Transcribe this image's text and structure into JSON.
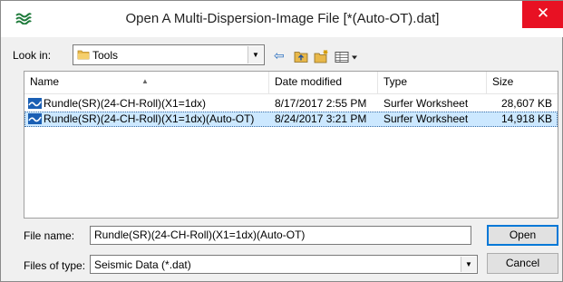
{
  "window": {
    "title": "Open A Multi-Dispersion-Image File [*(Auto-OT).dat]",
    "close_glyph": "✕"
  },
  "lookin": {
    "label": "Look in:",
    "value": "Tools",
    "icons": [
      "folder-icon",
      "back-arrow-icon",
      "up-folder-icon",
      "new-folder-icon",
      "view-menu-icon"
    ]
  },
  "columns": [
    "Name",
    "Date modified",
    "Type",
    "Size"
  ],
  "files": [
    {
      "name": "Rundle(SR)(24-CH-Roll)(X1=1dx)",
      "date": "8/17/2017 2:55 PM",
      "type": "Surfer Worksheet",
      "size": "28,607 KB",
      "selected": false
    },
    {
      "name": "Rundle(SR)(24-CH-Roll)(X1=1dx)(Auto-OT)",
      "date": "8/24/2017 3:21 PM",
      "type": "Surfer Worksheet",
      "size": "14,918 KB",
      "selected": true
    }
  ],
  "filename": {
    "label": "File name:",
    "value": "Rundle(SR)(24-CH-Roll)(X1=1dx)(Auto-OT)"
  },
  "filetype": {
    "label": "Files of type:",
    "value": "Seismic Data (*.dat)"
  },
  "buttons": {
    "open": "Open",
    "cancel": "Cancel"
  },
  "colors": {
    "selection": "#cce8ff",
    "close": "#e81123",
    "default_button_border": "#0078d7"
  }
}
